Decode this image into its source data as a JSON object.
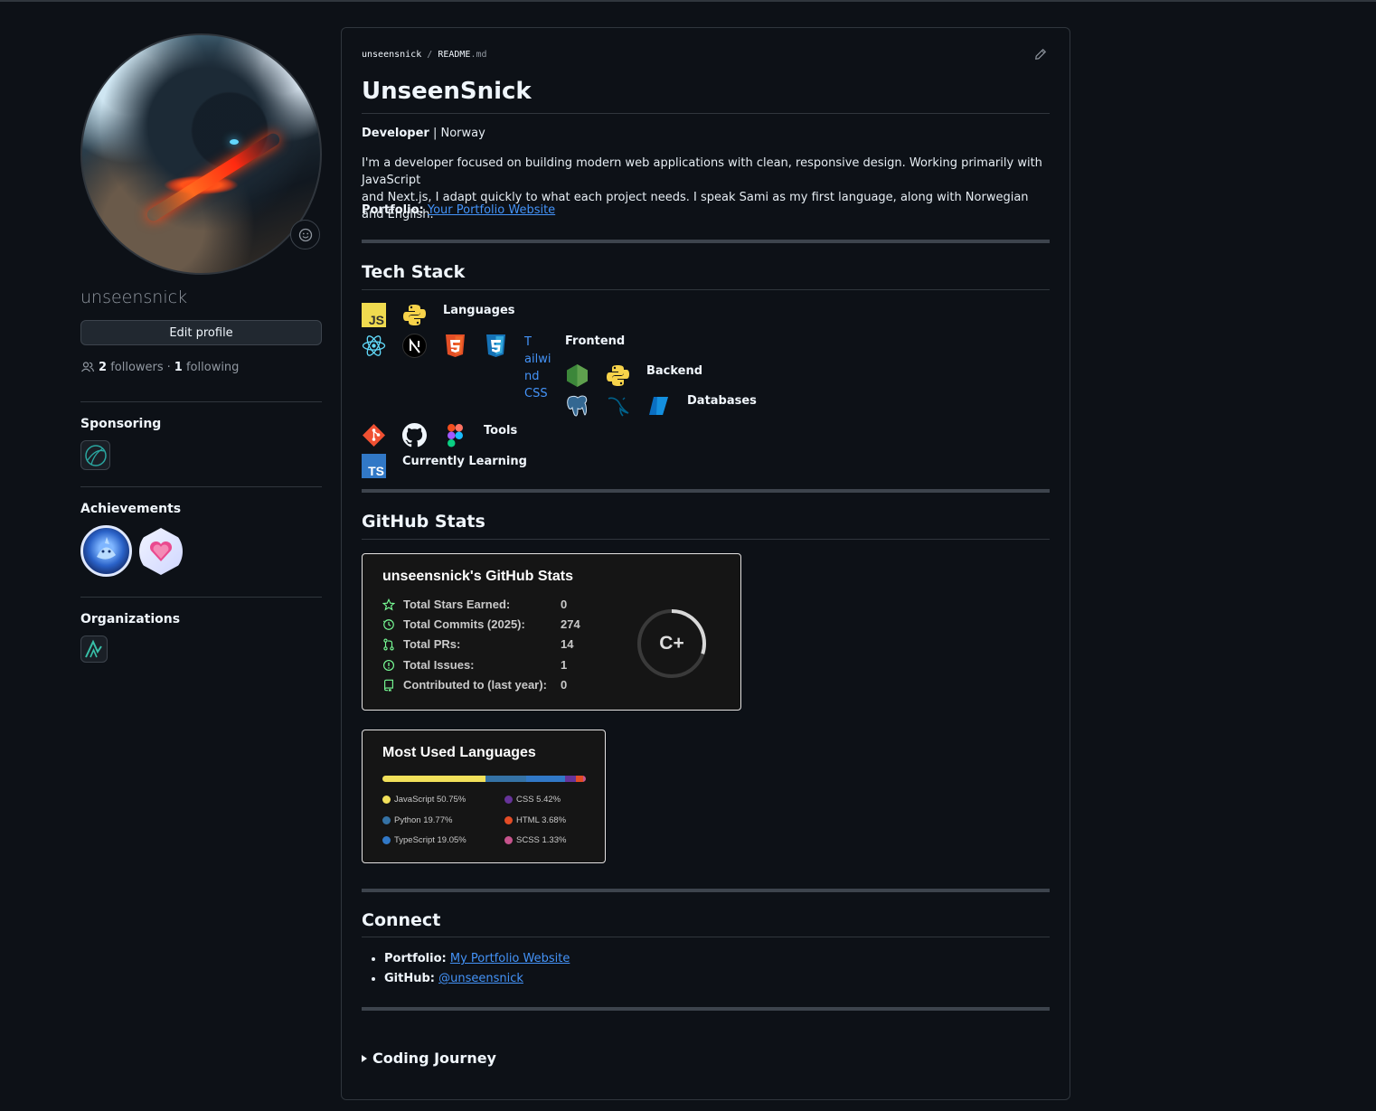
{
  "sidebar": {
    "username": "unseensnick",
    "edit_profile": "Edit profile",
    "followers_count": "2",
    "followers_label": "followers",
    "separator": "·",
    "following_count": "1",
    "following_label": "following",
    "sponsoring_heading": "Sponsoring",
    "achievements_heading": "Achievements",
    "organizations_heading": "Organizations"
  },
  "readme": {
    "path_user": "unseensnick",
    "path_sep": "/",
    "path_file": "README",
    "path_ext": ".md",
    "title": "UnseenSnick",
    "role": "Developer",
    "role_sep": "|",
    "location": "Norway",
    "bio_line1": "I'm a developer focused on building modern web applications with clean, responsive design. Working primarily with JavaScript",
    "bio_line2": "and Next.js, I adapt quickly to what each project needs. I speak Sami as my first language, along with Norwegian and English.",
    "portfolio_label": "Portfolio:",
    "portfolio_link": "Your Portfolio Website"
  },
  "tech": {
    "heading": "Tech Stack",
    "languages": "Languages",
    "frontend": "Frontend",
    "backend": "Backend",
    "databases": "Databases",
    "tools": "Tools",
    "learning": "Currently Learning",
    "tailwind_alt_l1": "T",
    "tailwind_alt_l2": "ailwi",
    "tailwind_alt_l3": "nd",
    "tailwind_alt_l4": "CSS"
  },
  "stats": {
    "heading": "GitHub Stats",
    "card_title": "unseensnick's GitHub Stats",
    "rows": [
      {
        "label": "Total Stars Earned:",
        "value": "0"
      },
      {
        "label": "Total Commits (2025):",
        "value": "274"
      },
      {
        "label": "Total PRs:",
        "value": "14"
      },
      {
        "label": "Total Issues:",
        "value": "1"
      },
      {
        "label": "Contributed to (last year):",
        "value": "0"
      }
    ],
    "grade": "C+",
    "grade_progress": 0.3
  },
  "langs": {
    "title": "Most Used Languages",
    "items": [
      {
        "name": "JavaScript 50.75%",
        "pct": 50.75,
        "color": "#f1e05a"
      },
      {
        "name": "Python 19.77%",
        "pct": 19.77,
        "color": "#3572A5"
      },
      {
        "name": "TypeScript 19.05%",
        "pct": 19.05,
        "color": "#3178c6"
      },
      {
        "name": "CSS 5.42%",
        "pct": 5.42,
        "color": "#663399"
      },
      {
        "name": "HTML 3.68%",
        "pct": 3.68,
        "color": "#e34c26"
      },
      {
        "name": "SCSS 1.33%",
        "pct": 1.33,
        "color": "#c6538c"
      }
    ]
  },
  "connect": {
    "heading": "Connect",
    "portfolio_label": "Portfolio:",
    "portfolio_link": "My Portfolio Website",
    "github_label": "GitHub:",
    "github_link": "@unseensnick"
  },
  "journey": {
    "summary": "Coding Journey"
  }
}
